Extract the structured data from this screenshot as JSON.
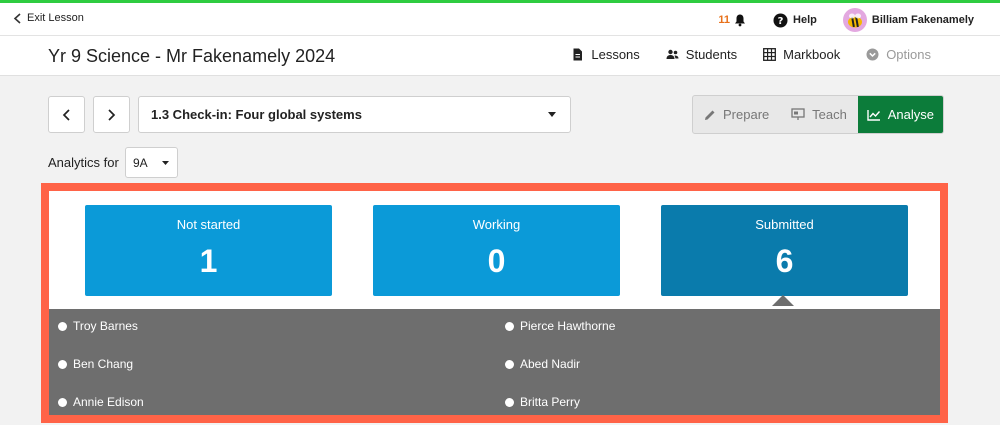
{
  "topbar": {
    "exit_label": "Exit Lesson",
    "notification_count": "11",
    "help_label": "Help",
    "user_name": "Billiam Fakenamely"
  },
  "header": {
    "course_title": "Yr 9 Science - Mr Fakenamely 2024",
    "nav": [
      {
        "label": "Lessons",
        "icon": "document-icon"
      },
      {
        "label": "Students",
        "icon": "people-icon"
      },
      {
        "label": "Markbook",
        "icon": "grid-icon"
      },
      {
        "label": "Options",
        "icon": "chevron-circle-icon"
      }
    ]
  },
  "lesson_bar": {
    "selected_lesson": "1.3 Check-in: Four global systems"
  },
  "modes": {
    "prepare": "Prepare",
    "teach": "Teach",
    "analyse": "Analyse",
    "active": "Analyse"
  },
  "analytics": {
    "label": "Analytics for",
    "class_value": "9A"
  },
  "status_cards": [
    {
      "label": "Not started",
      "value": "1"
    },
    {
      "label": "Working",
      "value": "0"
    },
    {
      "label": "Submitted",
      "value": "6"
    }
  ],
  "students": [
    "Troy Barnes",
    "Pierce Hawthorne",
    "Ben Chang",
    "Abed Nadir",
    "Annie Edison",
    "Britta Perry"
  ],
  "colors": {
    "accent_green": "#0c7c3a",
    "card_blue": "#0b9ad8",
    "card_active": "#0a7bac",
    "highlight_border": "#ff6347",
    "notification": "#e8711b"
  }
}
